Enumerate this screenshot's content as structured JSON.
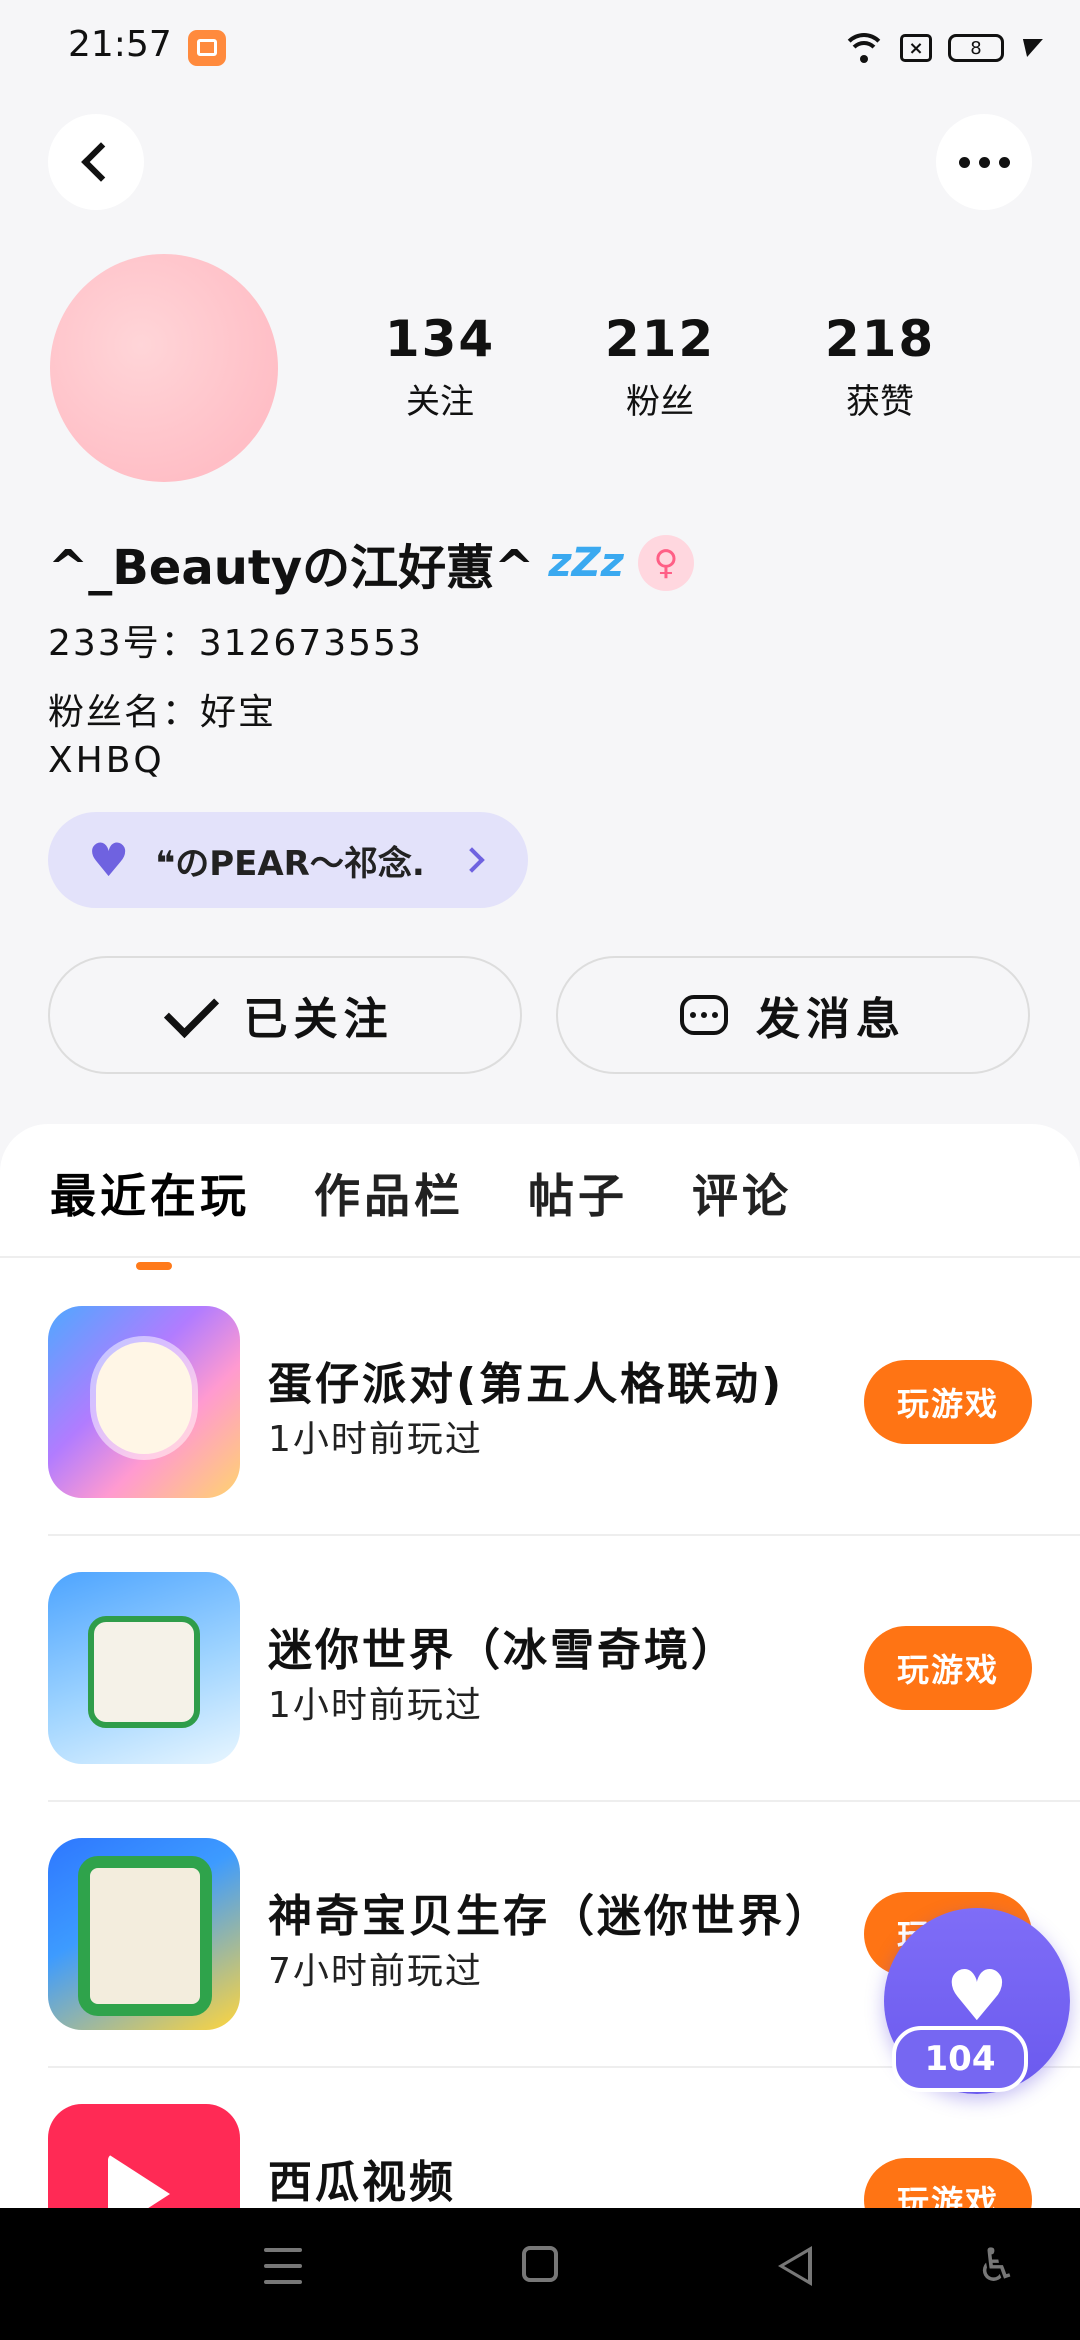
{
  "status_bar": {
    "time": "21:57",
    "sim_label": "×",
    "battery_level": "8"
  },
  "profile": {
    "stats": [
      {
        "value": "134",
        "label": "关注"
      },
      {
        "value": "212",
        "label": "粉丝"
      },
      {
        "value": "218",
        "label": "获赞"
      }
    ],
    "username": "^_Beautyの江好蕙^",
    "zzz": "zZz",
    "gender_icon": "♀",
    "id_line": "233号：312673553",
    "fan_name_line": "粉丝名：好宝",
    "tag_line": "XHBQ",
    "badge_text": "❝のPEAR〜祁念.",
    "badge_heart": "♥",
    "follow_button": "已关注",
    "message_button": "发消息"
  },
  "tabs": [
    "最近在玩",
    "作品栏",
    "帖子",
    "评论"
  ],
  "games": [
    {
      "title": "蛋仔派对(第五人格联动)",
      "played": "1小时前玩过",
      "button": "玩游戏"
    },
    {
      "title": "迷你世界（冰雪奇境）",
      "played": "1小时前玩过",
      "button": "玩游戏"
    },
    {
      "title": "神奇宝贝生存（迷你世界）",
      "played": "7小时前玩过",
      "button": "玩游戏"
    },
    {
      "title": "西瓜视频",
      "played": "",
      "button": "玩游戏"
    }
  ],
  "like_fab": {
    "icon": "♥",
    "count": "104"
  },
  "nav": {
    "accessibility_icon": "♿"
  },
  "colors": {
    "accent": "#ff7414",
    "fab": "#6f62e0"
  }
}
